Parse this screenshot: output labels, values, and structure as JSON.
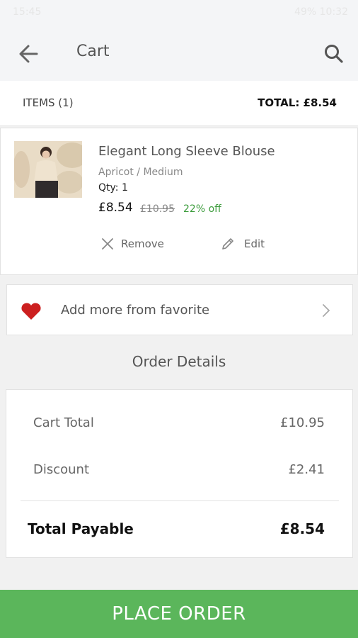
{
  "statusbar": {
    "time": "15:45",
    "right": "49% 10:32"
  },
  "appbar": {
    "title": "Cart"
  },
  "summary": {
    "items": "ITEMS (1)",
    "total": "TOTAL: £8.54"
  },
  "cart_item": {
    "name": "Elegant Long Sleeve Blouse",
    "variant": "Apricot / Medium",
    "qty": "Qty: 1",
    "price": "£8.54",
    "old_price": "£10.95",
    "discount": "22% off",
    "remove_label": "Remove",
    "edit_label": "Edit"
  },
  "favorite": {
    "label": "Add more from favorite"
  },
  "order_details": {
    "title": "Order Details",
    "rows": [
      {
        "label": "Cart Total",
        "value": "£10.95"
      },
      {
        "label": "Discount",
        "value": "£2.41"
      }
    ],
    "total_label": "Total Payable",
    "total_value": "£8.54"
  },
  "footer": {
    "place_order": "PLACE ORDER"
  },
  "colors": {
    "accent_green": "#5bb65b",
    "discount_green": "#3c9c3c",
    "heart_red": "#cc1f1f"
  }
}
